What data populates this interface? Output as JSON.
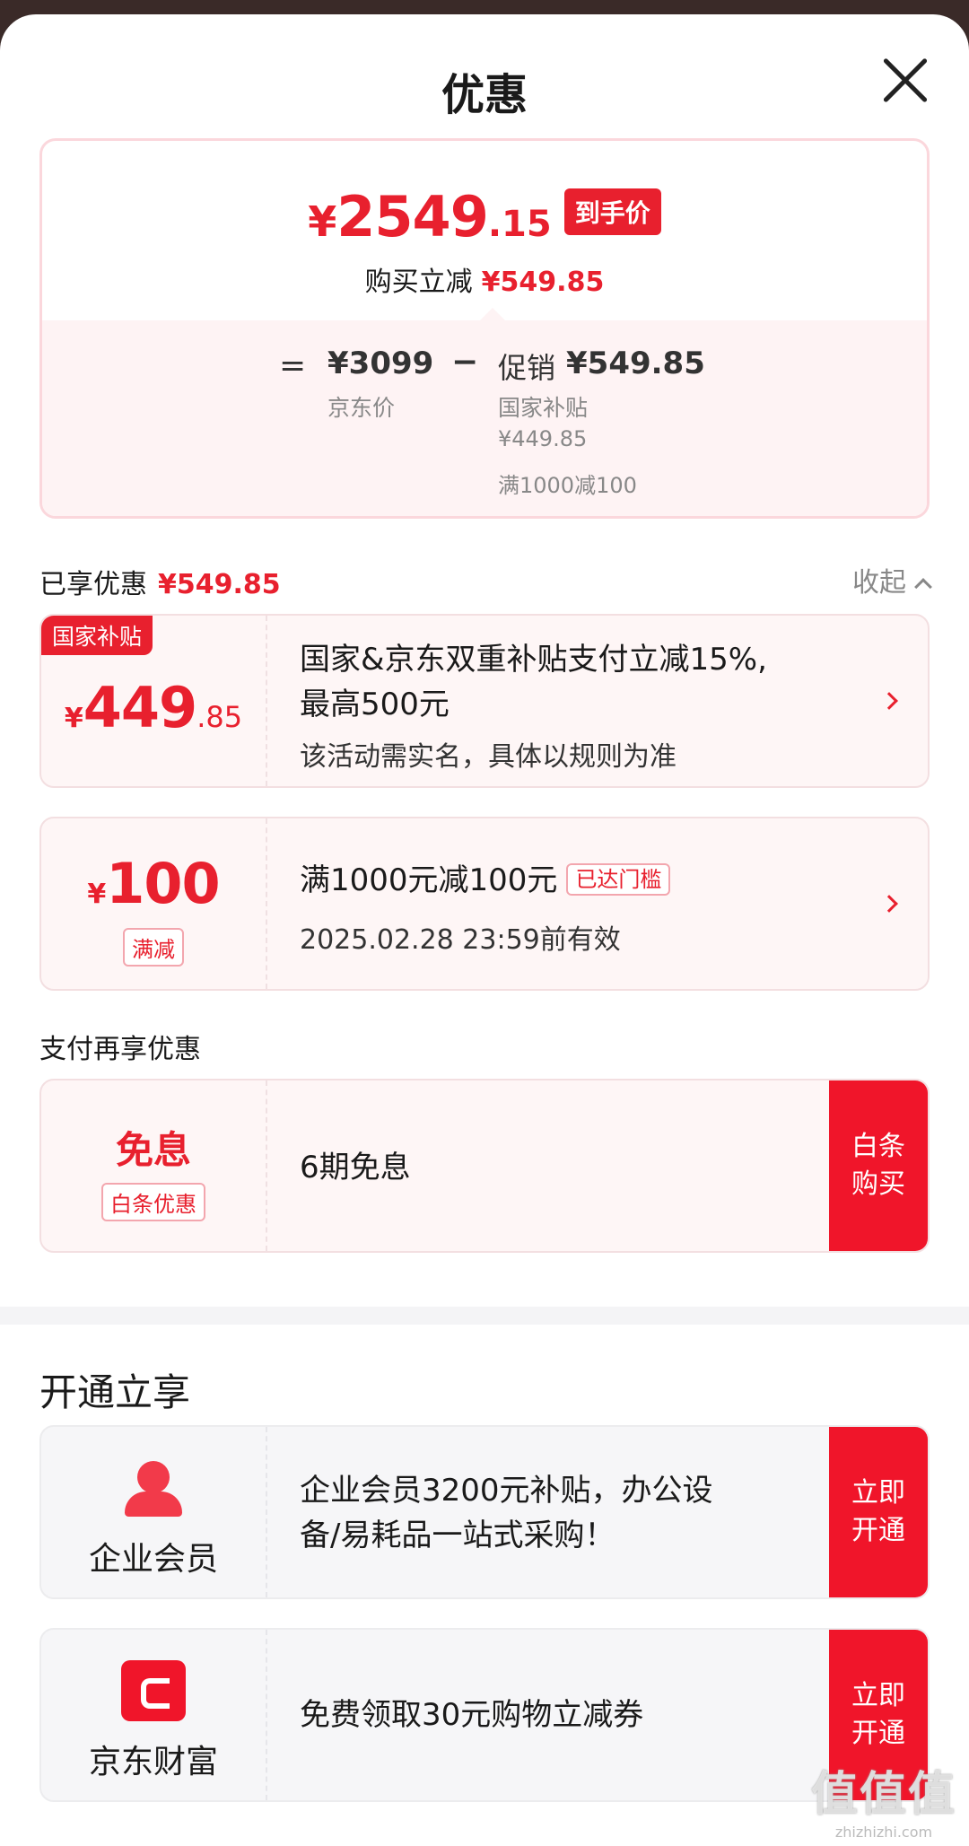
{
  "header": {
    "title": "优惠"
  },
  "price_summary": {
    "final_yen": "¥",
    "final_int": "2549",
    "final_dec": ".15",
    "final_tag": "到手价",
    "reduce_label": "购买立减",
    "reduce_value": "¥549.85",
    "equals": "=",
    "base_price": "¥3099",
    "base_label": "京东价",
    "minus": "−",
    "promo_label": "促销",
    "promo_value": "¥549.85",
    "promo_sub1": "国家补贴",
    "promo_sub2": "¥449.85",
    "promo_sub3": "满1000减100"
  },
  "enjoyed": {
    "label": "已享优惠",
    "value": "¥549.85",
    "collapse_label": "收起"
  },
  "coupons": [
    {
      "corner_tag": "国家补贴",
      "yen": "¥",
      "int": "449",
      "dec": ".85",
      "title_line1": "国家&京东双重补贴支付立减15%,",
      "title_line2": "最高500元",
      "subtitle": "该活动需实名，具体以规则为准"
    },
    {
      "yen": "¥",
      "int": "100",
      "tag": "满减",
      "title": "满1000元减100元",
      "reached_tag": "已达门槛",
      "subtitle": "2025.02.28 23:59前有效"
    }
  ],
  "payment": {
    "section_title": "支付再享优惠",
    "card": {
      "headline": "免息",
      "tag": "白条优惠",
      "description": "6期免息",
      "button_line1": "白条",
      "button_line2": "购买"
    }
  },
  "membership": {
    "section_title": "开通立享",
    "items": [
      {
        "icon": "person-icon",
        "label": "企业会员",
        "line1": "企业会员3200元补贴，办公设",
        "line2": "备/易耗品一站式采购！",
        "button_line1": "立即",
        "button_line2": "开通"
      },
      {
        "icon": "wallet-icon",
        "label": "京东财富",
        "line1": "免费领取30元购物立减券",
        "button_line1": "立即",
        "button_line2": "开通"
      }
    ]
  },
  "watermark": {
    "line1": "值值值",
    "line2": "zhizhizhi.com"
  },
  "colors": {
    "accent": "#e8202e",
    "button": "#f0152a",
    "card_pink": "#fef6f6",
    "card_gray": "#f6f6f8"
  }
}
